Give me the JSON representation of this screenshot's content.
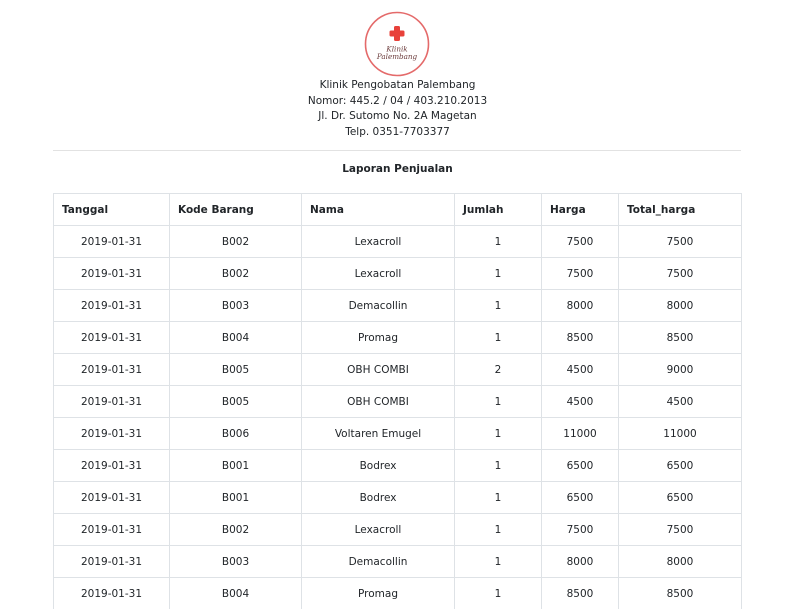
{
  "logo": {
    "line1": "Klinik",
    "line2": "Palembang",
    "cross_color": "#e8413a",
    "ring_color": "#e46a6a"
  },
  "clinic": {
    "name": "Klinik Pengobatan Palembang",
    "number": "Nomor: 445.2 / 04 / 403.210.2013",
    "address": "Jl. Dr. Sutomo No. 2A Magetan",
    "phone": "Telp. 0351-7703377"
  },
  "report": {
    "title": "Laporan Penjualan",
    "columns": [
      "Tanggal",
      "Kode Barang",
      "Nama",
      "Jumlah",
      "Harga",
      "Total_harga"
    ],
    "rows": [
      [
        "2019-01-31",
        "B002",
        "Lexacroll",
        "1",
        "7500",
        "7500"
      ],
      [
        "2019-01-31",
        "B002",
        "Lexacroll",
        "1",
        "7500",
        "7500"
      ],
      [
        "2019-01-31",
        "B003",
        "Demacollin",
        "1",
        "8000",
        "8000"
      ],
      [
        "2019-01-31",
        "B004",
        "Promag",
        "1",
        "8500",
        "8500"
      ],
      [
        "2019-01-31",
        "B005",
        "OBH COMBI",
        "2",
        "4500",
        "9000"
      ],
      [
        "2019-01-31",
        "B005",
        "OBH COMBI",
        "1",
        "4500",
        "4500"
      ],
      [
        "2019-01-31",
        "B006",
        "Voltaren Emugel",
        "1",
        "11000",
        "11000"
      ],
      [
        "2019-01-31",
        "B001",
        "Bodrex",
        "1",
        "6500",
        "6500"
      ],
      [
        "2019-01-31",
        "B001",
        "Bodrex",
        "1",
        "6500",
        "6500"
      ],
      [
        "2019-01-31",
        "B002",
        "Lexacroll",
        "1",
        "7500",
        "7500"
      ],
      [
        "2019-01-31",
        "B003",
        "Demacollin",
        "1",
        "8000",
        "8000"
      ],
      [
        "2019-01-31",
        "B004",
        "Promag",
        "1",
        "8500",
        "8500"
      ]
    ]
  }
}
